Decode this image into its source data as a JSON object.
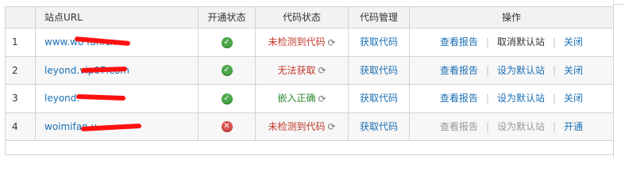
{
  "table": {
    "headers": {
      "url": "站点URL",
      "open_status": "开通状态",
      "code_status": "代码状态",
      "code_manage": "代码管理",
      "operations": "操作"
    },
    "rows": [
      {
        "index": "1",
        "url": "www.wo      fan.cn",
        "open_ok": true,
        "open_icon": "check-circle-icon",
        "code_status": "未检测到代码",
        "code_status_color": "#c0392b",
        "code_manage": "获取代码",
        "ops": [
          "查看报告",
          "取消默认站",
          "关闭"
        ],
        "ops_disabled": [
          false,
          false,
          false
        ]
      },
      {
        "index": "2",
        "url": "leyond.vip07.com",
        "open_ok": true,
        "open_icon": "check-circle-icon",
        "code_status": "无法获取",
        "code_status_color": "#c0392b",
        "code_manage": "获取代码",
        "ops": [
          "查看报告",
          "设为默认站",
          "关闭"
        ],
        "ops_disabled": [
          false,
          false,
          false
        ]
      },
      {
        "index": "3",
        "url": "leyond.",
        "open_ok": true,
        "open_icon": "check-circle-icon",
        "code_status": "嵌入正确",
        "code_status_color": "#2e8b2e",
        "code_manage": "获取代码",
        "ops": [
          "查看报告",
          "设为默认站",
          "关闭"
        ],
        "ops_disabled": [
          false,
          false,
          false
        ]
      },
      {
        "index": "4",
        "url": "woimifan      u",
        "open_ok": false,
        "open_icon": "x-circle-icon",
        "code_status": "未检测到代码",
        "code_status_color": "#c0392b",
        "code_manage": "获取代码",
        "ops": [
          "查看报告",
          "设为默认站",
          "开通"
        ],
        "ops_disabled": [
          true,
          true,
          false
        ]
      }
    ]
  }
}
